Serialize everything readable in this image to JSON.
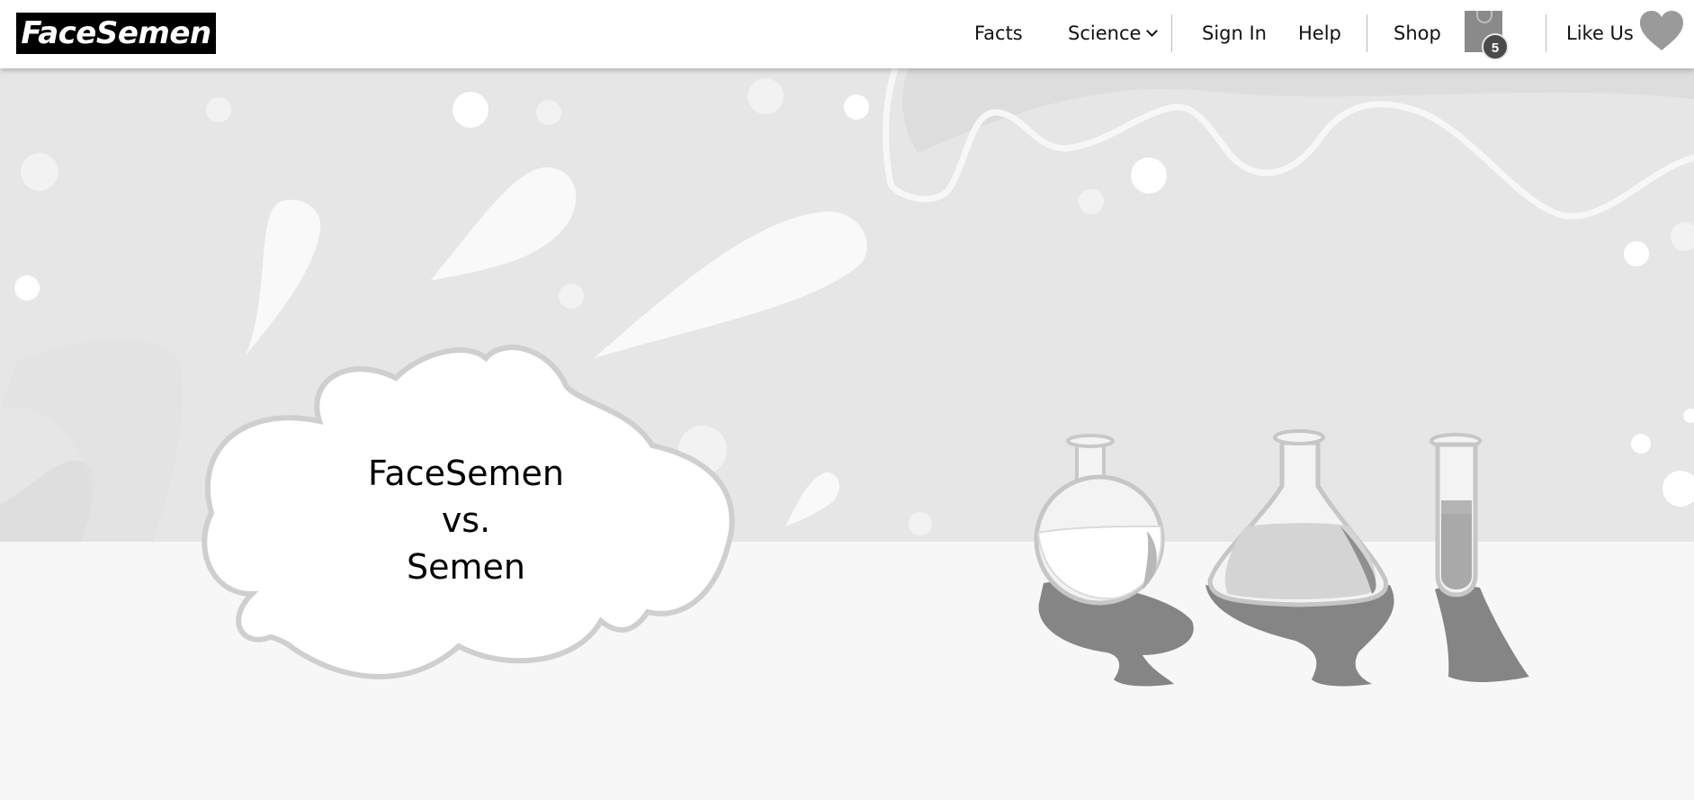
{
  "header": {
    "logo_text": "FaceSemen",
    "nav": {
      "facts": "Facts",
      "science": "Science",
      "sign_in": "Sign In",
      "help": "Help",
      "shop": "Shop",
      "like_us": "Like Us"
    },
    "cart_count": "5"
  },
  "hero": {
    "bubble_lines": [
      "FaceSemen",
      "vs.",
      "Semen"
    ]
  },
  "icons": [
    "chevron-down-icon",
    "shopping-bag-icon",
    "heart-icon"
  ],
  "colors": {
    "background_top": "#e6e6e6",
    "background_floor": "#f7f7f7",
    "shadow": "#858585",
    "logo_bg": "#000000"
  }
}
